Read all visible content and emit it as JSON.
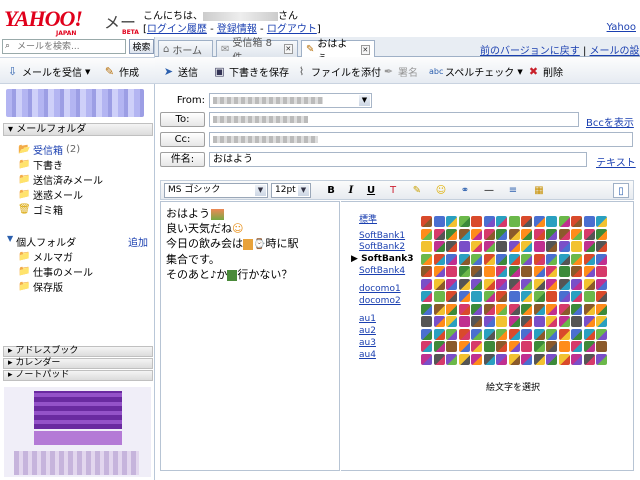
{
  "header": {
    "brand": "YAHOO!",
    "brand_sub": "JAPAN",
    "product": "メール",
    "beta": "BETA",
    "greeting_prefix": "こんにちは、",
    "greeting_suffix": "さん",
    "links": [
      "ログイン履歴",
      "登録情報",
      "ログアウト"
    ],
    "yahoo_link": "Yahoo"
  },
  "search": {
    "placeholder": "メールを検索...",
    "button": "検索"
  },
  "left_toolbar": {
    "receive": "メールを受信",
    "compose": "作成"
  },
  "folders": {
    "header": "メールフォルダ",
    "items": [
      {
        "label": "受信箱",
        "count": "(2)"
      },
      {
        "label": "下書き"
      },
      {
        "label": "送信済みメール"
      },
      {
        "label": "迷惑メール"
      },
      {
        "label": "ゴミ箱"
      }
    ],
    "personal_header": "個人フォルダ",
    "add": "追加",
    "personal_items": [
      "メルマガ",
      "仕事のメール",
      "保存版"
    ]
  },
  "collapsed_sections": [
    "アドレスブック",
    "カレンダー",
    "ノートパッド"
  ],
  "tabs": [
    {
      "label": "ホーム"
    },
    {
      "label": "受信箱 8件"
    },
    {
      "label": "おはよう"
    }
  ],
  "top_links": {
    "prev_version": "前のバージョンに戻す",
    "settings": "メールの設定"
  },
  "compose_toolbar": {
    "send": "送信",
    "save_draft": "下書きを保存",
    "attach": "ファイルを添付",
    "signature": "署名",
    "spellcheck": "スペルチェック",
    "delete": "削除"
  },
  "form": {
    "from_label": "From:",
    "to_label": "To:",
    "cc_label": "Cc:",
    "subject_label": "件名:",
    "subject_value": "おはよう",
    "bcc_link": "Bccを表示",
    "text_link": "テキスト"
  },
  "editor_toolbar": {
    "font": "MS ゴシック",
    "size": "12pt"
  },
  "body_lines": [
    "おはよう",
    "良い天気だね",
    "今日の飲み会は",
    "時に駅",
    "集合です。",
    "そのあと",
    "か",
    "行かない？"
  ],
  "carriers": [
    "標準",
    "SoftBank1",
    "SoftBank2",
    "SoftBank3",
    "SoftBank4",
    "docomo1",
    "docomo2",
    "au1",
    "au2",
    "au3",
    "au4"
  ],
  "emoji_caption": "絵文字を選択",
  "colors": {
    "accent_link": "#1a3fb0",
    "brand_red": "#e0001b",
    "emoji_palette": [
      "#d94a2b",
      "#3c8a3a",
      "#f2c230",
      "#4a6fd0",
      "#8b5a2b",
      "#c03090",
      "#2aa0c0",
      "#ff8c1a",
      "#555555",
      "#6bb84a",
      "#d63a6a",
      "#7a4fc8"
    ]
  }
}
